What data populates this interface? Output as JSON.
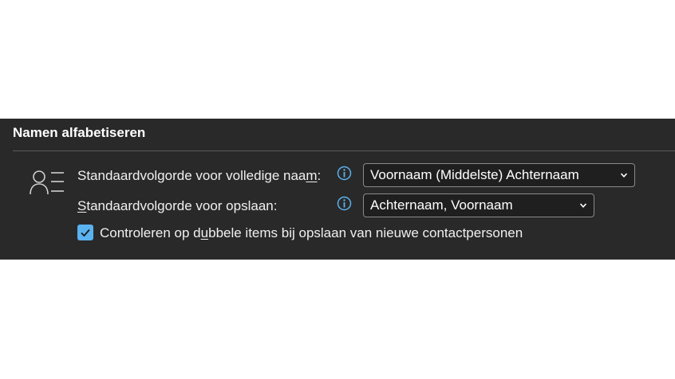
{
  "section": {
    "title": "Namen alfabetiseren"
  },
  "icons": {
    "section_icon": "contact-list-icon",
    "info_icon": "info-icon",
    "dropdown_icon": "chevron-down-icon",
    "check_icon": "checkmark-icon"
  },
  "colors": {
    "panel_background": "#292929",
    "checkbox_accent": "#5ab2f0",
    "info_accent": "#5ab2f0"
  },
  "full_name_order": {
    "label_before": "Standaardvolgorde voor volledige naa",
    "label_accel": "m",
    "label_after": ":",
    "selected_value": "Voornaam (Middelste) Achternaam"
  },
  "save_order": {
    "label_accel": "S",
    "label_after": "tandaardvolgorde voor opslaan:",
    "selected_value": "Achternaam, Voornaam"
  },
  "duplicate_check": {
    "checked": true,
    "label_before": "Controleren op d",
    "label_accel": "u",
    "label_after": "bbele items bij opslaan van nieuwe contactpersonen"
  }
}
